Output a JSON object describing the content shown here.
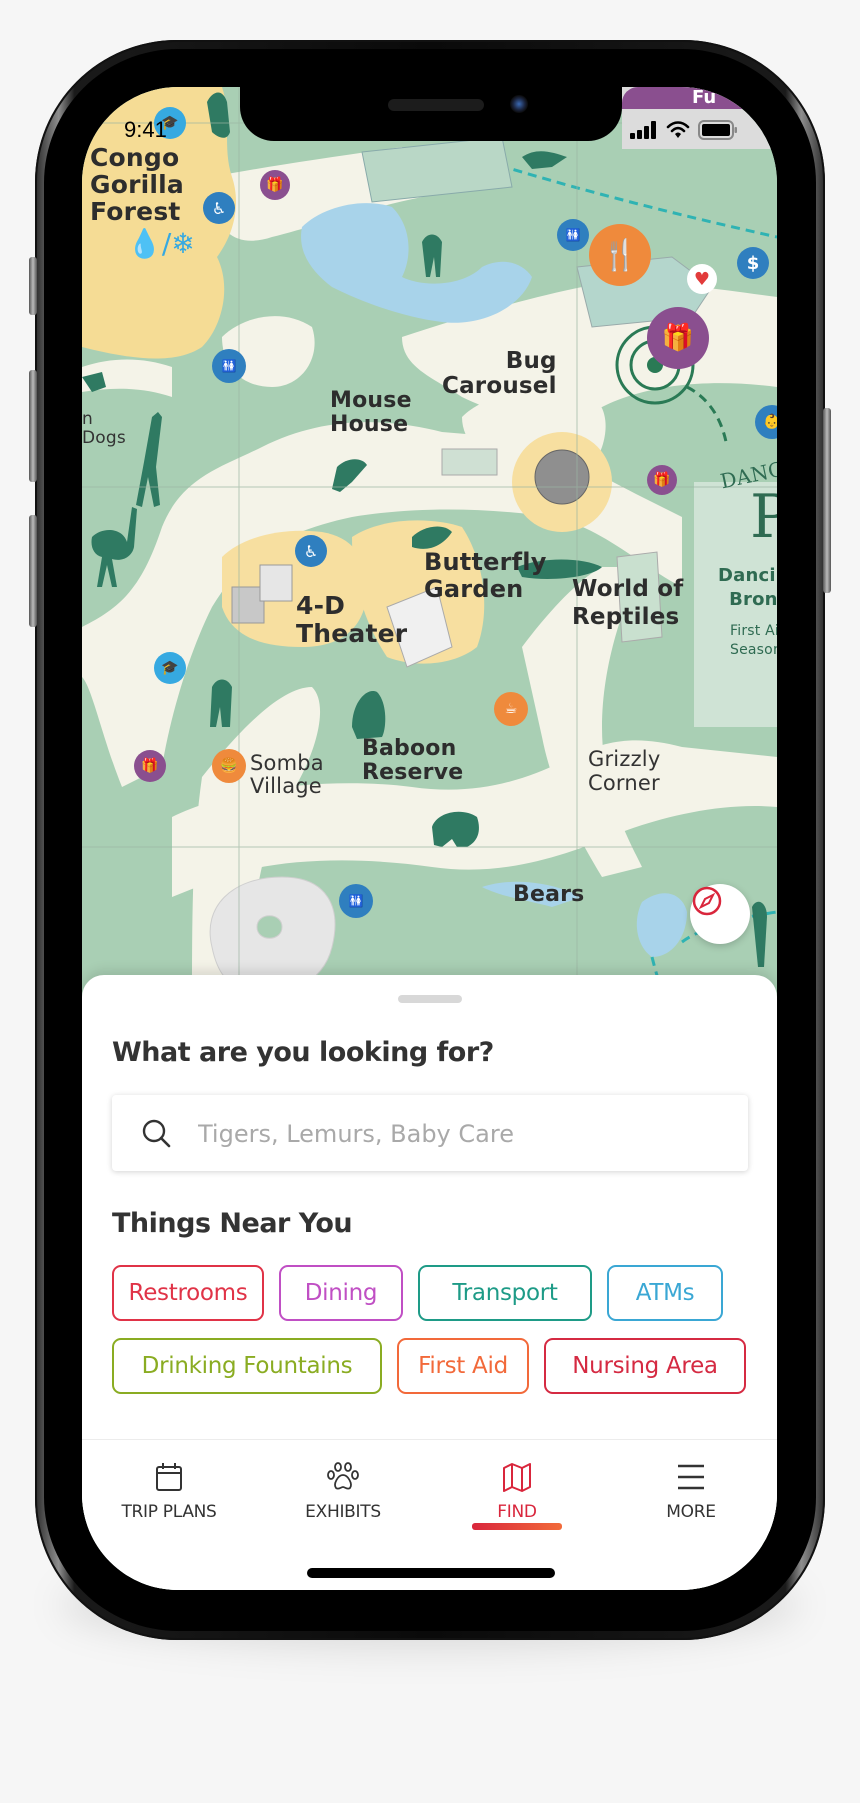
{
  "status_bar": {
    "time": "9:41",
    "icons": [
      "signal-icon",
      "wifi-icon",
      "battery-icon"
    ],
    "partial_banner_text": "Fu"
  },
  "map": {
    "labels": {
      "congo": "Congo\nGorilla\nForest",
      "mouse_house": "Mouse\nHouse",
      "bug_carousel": "Bug\nCarousel",
      "butterfly": "Butterfly\nGarden",
      "theater": "4-D\nTheater",
      "reptiles": "World of\nReptiles",
      "somba": "Somba\nVillage",
      "baboon": "Baboon\nReserve",
      "grizzly": "Grizzly\nCorner",
      "bears": "Bears",
      "dogs": "n\nDogs",
      "dancing": "Dancin\nBron",
      "dancing_sub": "First Aid\nSeason",
      "dancing_banner": "DANC",
      "dancing_big": "P"
    },
    "pois": [
      {
        "type": "restroom-icon",
        "color": "#2f7fbf"
      },
      {
        "type": "gift-shop-icon",
        "color": "#8a4f8f"
      },
      {
        "type": "dining-icon",
        "color": "#ef8a3c"
      },
      {
        "type": "atm-icon",
        "color": "#2f7fbf"
      },
      {
        "type": "first-aid-icon",
        "color": "#e23b3b"
      },
      {
        "type": "hearing-assist-icon",
        "color": "#2f7fbf"
      },
      {
        "type": "education-icon",
        "color": "#36a9e1"
      },
      {
        "type": "cafe-icon",
        "color": "#ef8a3c"
      },
      {
        "type": "nursing-icon",
        "color": "#2f7fbf"
      }
    ],
    "compass_button": "compass-icon"
  },
  "sheet": {
    "title": "What are you looking for?",
    "search": {
      "placeholder": "Tigers, Lemurs, Baby Care",
      "value": ""
    },
    "near_title": "Things Near You",
    "chips": [
      [
        {
          "label": "Restrooms",
          "color": "#e03347"
        },
        {
          "label": "Dining",
          "color": "#c04fc4"
        },
        {
          "label": "Transport",
          "color": "#1e9b87"
        },
        {
          "label": "ATMs",
          "color": "#3aa7d4"
        }
      ],
      [
        {
          "label": "Drinking Fountains",
          "color": "#8aac22"
        },
        {
          "label": "First Aid",
          "color": "#f2693a"
        },
        {
          "label": "Nursing Area",
          "color": "#d52a42"
        }
      ]
    ]
  },
  "tabbar": {
    "tabs": [
      {
        "label": "TRIP PLANS",
        "icon": "calendar-icon",
        "active": false
      },
      {
        "label": "EXHIBITS",
        "icon": "paw-icon",
        "active": false
      },
      {
        "label": "FIND",
        "icon": "map-icon",
        "active": true
      },
      {
        "label": "MORE",
        "icon": "menu-icon",
        "active": false
      }
    ],
    "active_color": "#d9263c"
  }
}
